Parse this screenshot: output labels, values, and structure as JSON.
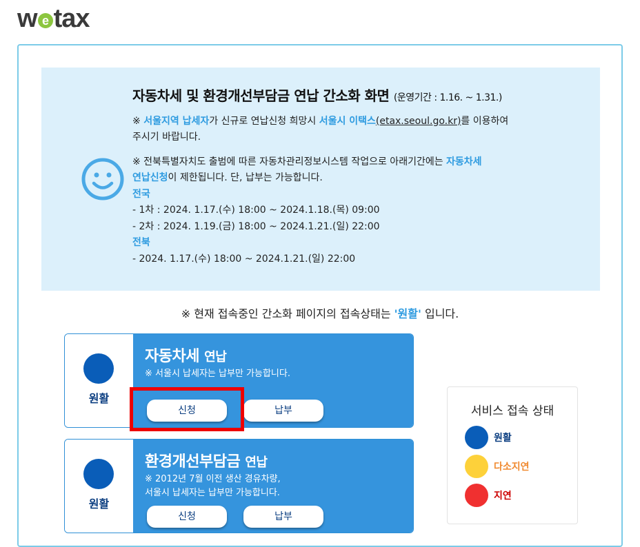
{
  "logo": {
    "part1": "w",
    "e": "e",
    "part2": "tax"
  },
  "notice": {
    "title": "자동차세 및 환경개선부담금 연납 간소화 화면",
    "period": "(운영기간 : 1.16. ~ 1.31.)",
    "line1_prefix": "※ ",
    "line1_region": "서울지역 납세자",
    "line1_mid": "가 신규로 연납신청 희망시 ",
    "line1_site": "서울시 이택스",
    "line1_url": "(etax.seoul.go.kr)",
    "line1_suffix": "를 이용하여",
    "line1_cont": "주시기 바랍니다.",
    "line2_text": "※ 전북특별자치도 출범에 따른 자동차관리정보시스템 작업으로 아래기간에는 ",
    "line2_hl": "자동차세",
    "line2_hl2": "연납신청",
    "line2_suffix": "이 제한됩니다. 단, 납부는 가능합니다.",
    "region1": "전국",
    "r1_item1": "- 1차 : 2024. 1.17.(수) 18:00 ~ 2024.1.18.(목) 09:00",
    "r1_item2": "- 2차 : 2024. 1.19.(금) 18:00 ~ 2024.1.21.(일) 22:00",
    "region2": "전북",
    "r2_item1": "- 2024. 1.17.(수) 18:00 ~ 2024.1.21.(일) 22:00"
  },
  "status_line": {
    "prefix": "※ 현재 접속중인 간소화 페이지의 접속상태는 ",
    "status": "'원활'",
    "suffix": " 입니다."
  },
  "cards": [
    {
      "status": "원활",
      "title": "자동차세",
      "title_suffix": "연납",
      "note1": "※ 서울시 납세자는 납부만 가능합니다.",
      "apply": "신청",
      "pay": "납부"
    },
    {
      "status": "원활",
      "title": "환경개선부담금",
      "title_suffix": "연납",
      "note1": "※ 2012년 7월 이전 생산 경유차량,",
      "note2": "서울시 납세자는 납부만 가능합니다.",
      "apply": "신청",
      "pay": "납부"
    }
  ],
  "legend": {
    "title": "서비스 접속 상태",
    "items": [
      {
        "label": "원활",
        "color": "#0a5db8",
        "text_color": "#0a3d80"
      },
      {
        "label": "다소지연",
        "color": "#fdd13a",
        "text_color": "#f08a30"
      },
      {
        "label": "지연",
        "color": "#f03030",
        "text_color": "#cc0000"
      }
    ]
  }
}
